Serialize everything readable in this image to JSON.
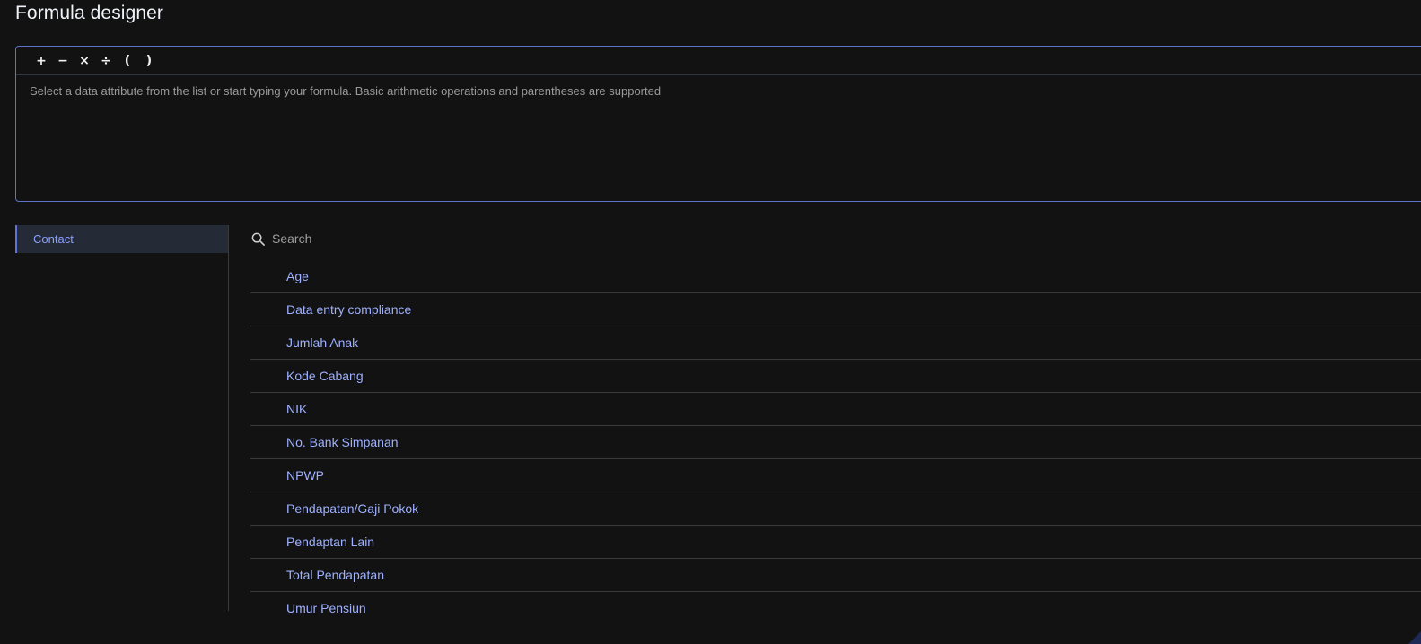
{
  "page": {
    "title": "Formula designer"
  },
  "toolbar": {
    "operators": [
      {
        "symbol": "+",
        "name": "plus"
      },
      {
        "symbol": "−",
        "name": "minus"
      },
      {
        "symbol": "×",
        "name": "multiply"
      },
      {
        "symbol": "÷",
        "name": "divide"
      },
      {
        "symbol": "(",
        "name": "open-paren"
      },
      {
        "symbol": ")",
        "name": "close-paren"
      }
    ]
  },
  "editor": {
    "value": "",
    "placeholder": "Select a data attribute from the list or start typing your formula. Basic arithmetic operations and parentheses are supported"
  },
  "sidebar": {
    "items": [
      {
        "label": "Contact",
        "selected": true
      }
    ]
  },
  "search": {
    "placeholder": "Search",
    "icon": "search-icon"
  },
  "attributes": [
    "Age",
    "Data entry compliance",
    "Jumlah Anak",
    "Kode Cabang",
    "NIK",
    "No. Bank Simpanan",
    "NPWP",
    "Pendapatan/Gaji Pokok",
    "Pendaptan Lain",
    "Total Pendapatan",
    "Umur Pensiun"
  ],
  "colors": {
    "background": "#121212",
    "accent": "#8aa0ff",
    "border": "#5b73c8",
    "sidebar_selected_bg": "#252a37"
  }
}
